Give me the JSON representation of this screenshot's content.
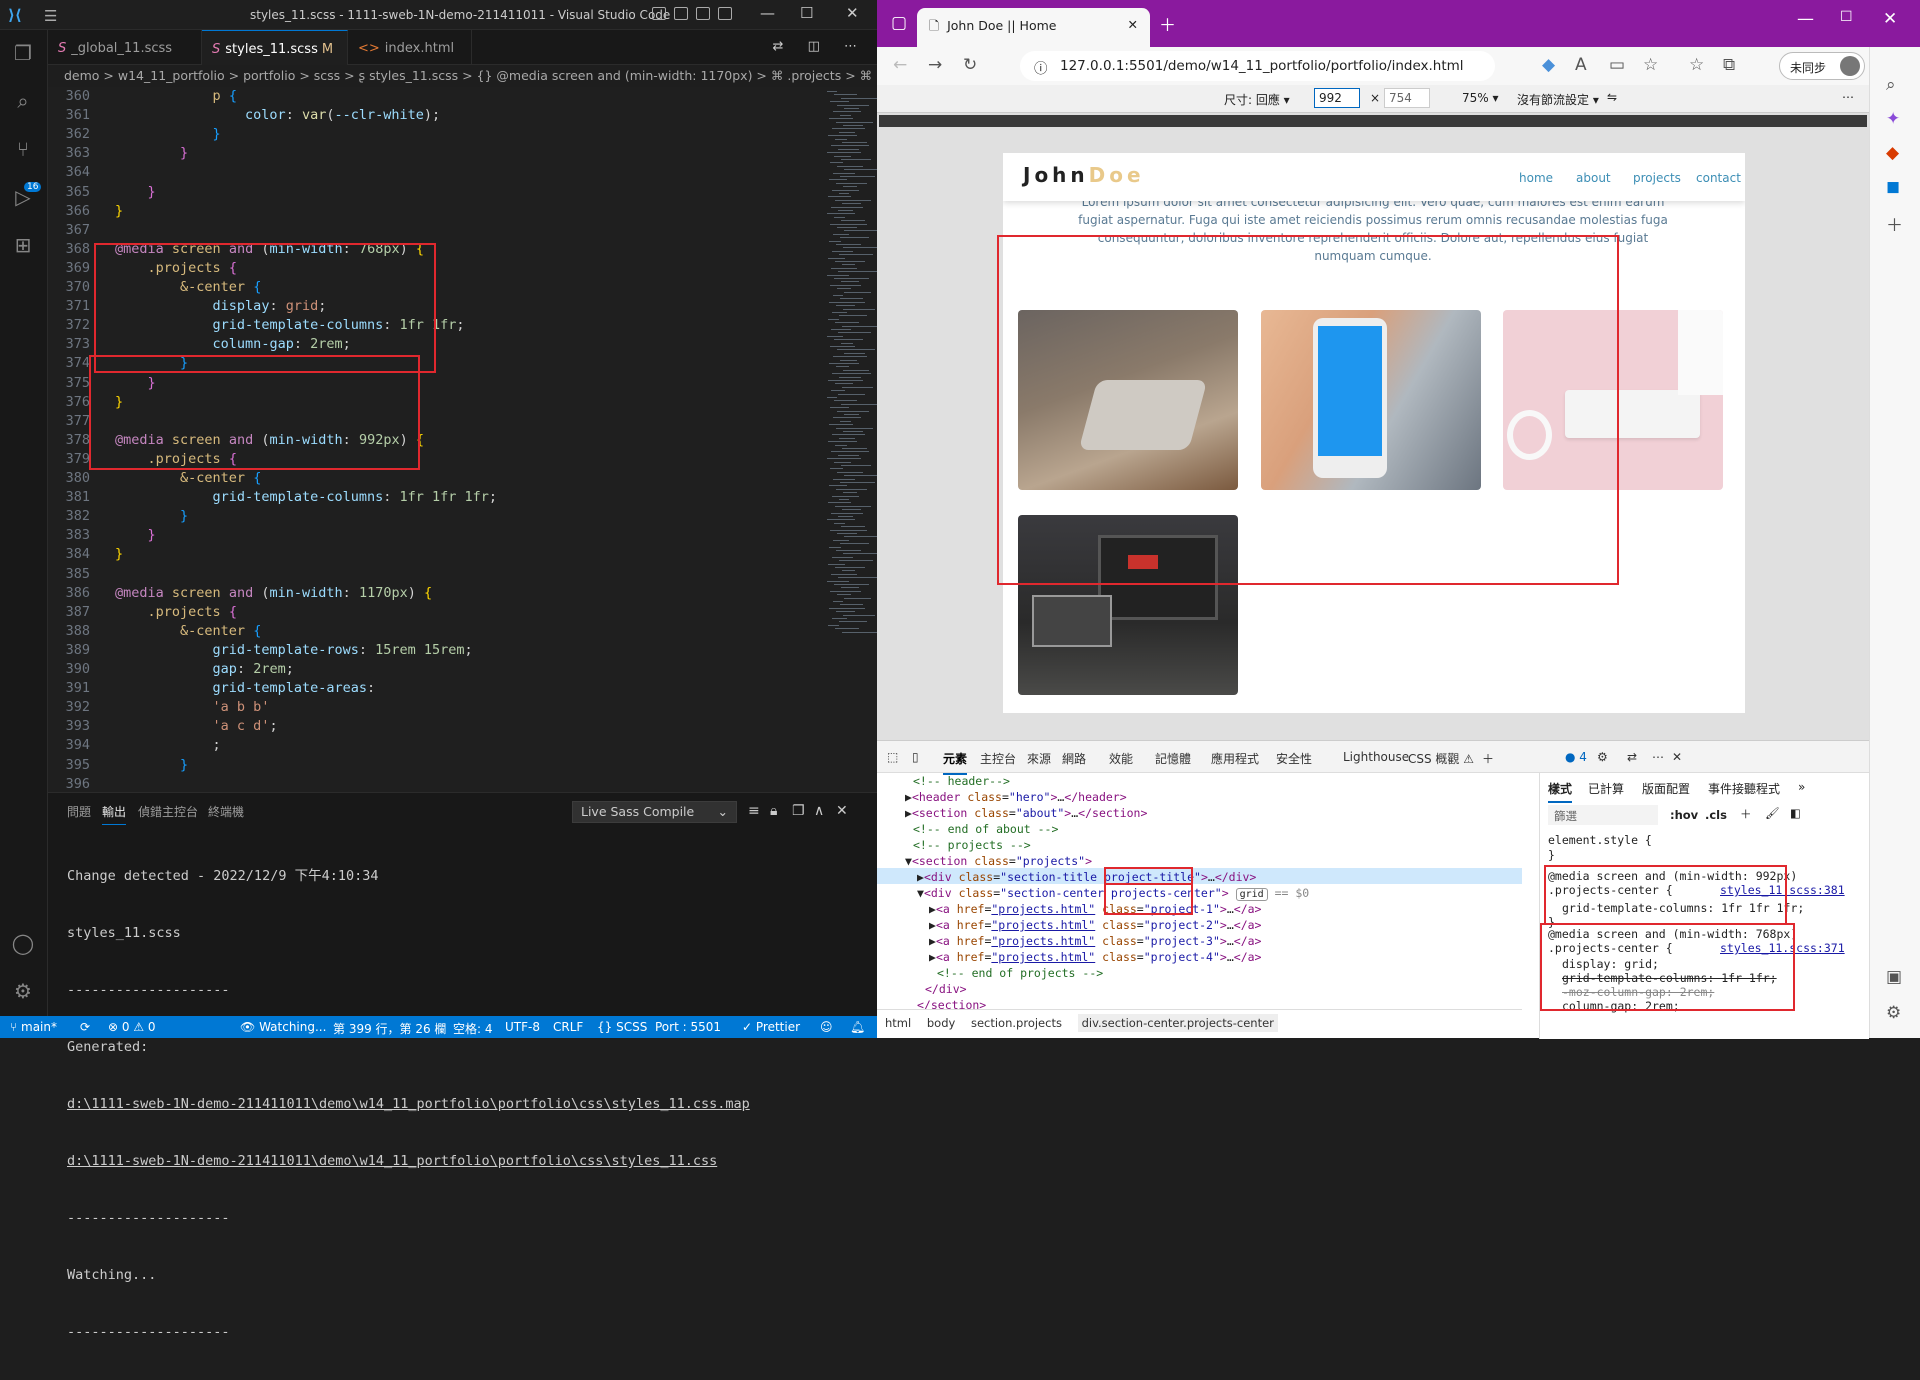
{
  "vscode": {
    "window_title": "styles_11.scss - 1111-sweb-1N-demo-211411011 - Visual Studio Code",
    "tabs": [
      {
        "icon": "S",
        "label": "_global_11.scss",
        "modified": ""
      },
      {
        "icon": "S",
        "label": "styles_11.scss",
        "modified": "M"
      },
      {
        "icon": "<>",
        "label": "index.html",
        "modified": ""
      }
    ],
    "breadcrumb": "demo > w14_11_portfolio > portfolio > scss > ʂ styles_11.scss > {} @media screen and (min-width: 1170px) > ⌘ .projects > ⌘ .project",
    "scm_badge": "16",
    "line_numbers": [
      "360",
      "361",
      "362",
      "363",
      "364",
      "365",
      "366",
      "367",
      "368",
      "369",
      "370",
      "371",
      "372",
      "373",
      "374",
      "375",
      "376",
      "377",
      "378",
      "379",
      "380",
      "381",
      "382",
      "383",
      "384",
      "385",
      "386",
      "387",
      "388",
      "389",
      "390",
      "391",
      "392",
      "393",
      "394",
      "395",
      "396"
    ],
    "panel": {
      "tabs": [
        "問題",
        "輸出",
        "偵錯主控台",
        "終端機"
      ],
      "output_channel": "Live Sass Compile",
      "output_lines": [
        "Change detected - 2022/12/9 下午4:10:34",
        "styles_11.scss",
        "--------------------",
        "Generated:",
        "d:\\1111-sweb-1N-demo-211411011\\demo\\w14_11_portfolio\\portfolio\\css\\styles_11.css.map",
        "d:\\1111-sweb-1N-demo-211411011\\demo\\w14_11_portfolio\\portfolio\\css\\styles_11.css",
        "--------------------",
        "Watching...",
        "--------------------"
      ]
    },
    "status": {
      "branch": "main*",
      "errors": "⊗ 0 ⚠ 0",
      "watching": "Watching...",
      "position": "第 399 行，第 26 欄",
      "spaces": "空格: 4",
      "encoding": "UTF-8",
      "eol": "CRLF",
      "language": "{} SCSS",
      "port": "Port : 5501",
      "prettier": "✓ Prettier"
    },
    "colors": {
      "accent": "#0078d4",
      "highlight_box": "#e0282e"
    }
  },
  "edge": {
    "tab_title": "John Doe || Home",
    "url": "127.0.0.1:5501/demo/w14_11_portfolio/portfolio/index.html",
    "profile_label": "未同步",
    "device_toolbar": {
      "size_label": "尺寸: 回應",
      "width": "992",
      "height": "754",
      "zoom": "75%",
      "throttle": "沒有節流設定"
    },
    "page": {
      "logo_first": "John",
      "logo_last": "Doe",
      "nav": [
        "home",
        "about",
        "projects",
        "contact"
      ],
      "about_text": "Lorem ipsum dolor sit amet consectetur adipisicing elit. Vero quae, cum maiores est enim earum fugiat aspernatur. Fuga qui iste amet reiciendis possimus rerum omnis recusandae molestias fuga consequuntur, doloribus inventore reprehenderit officiis. Dolore aut, repellendus eius fugiat numquam cumque."
    },
    "devtools": {
      "tabs": [
        "元素",
        "主控台",
        "來源",
        "網路",
        "效能",
        "記憶體",
        "應用程式",
        "安全性",
        "Lighthouse",
        "CSS 概觀 ⚠"
      ],
      "issue_count": "4",
      "styles_tabs": [
        "樣式",
        "已計算",
        "版面配置",
        "事件接聽程式"
      ],
      "filter_placeholder": "篩選",
      "hov": ":hov",
      "cls": ".cls",
      "grid_badge": "grid",
      "crumbs": [
        "html",
        "body",
        "section.projects",
        "div.section-center.projects-center"
      ],
      "style_rules": {
        "element_style": "element.style {",
        "rule1_media": "@media screen and (min-width: 992px)",
        "rule1_selector": ".projects-center {",
        "rule1_link": "styles_11.scss:381",
        "rule1_decl": "grid-template-columns: 1fr 1fr 1fr;",
        "rule2_media": "@media screen and (min-width: 768px)",
        "rule2_selector": ".projects-center {",
        "rule2_link": "styles_11.scss:371",
        "rule2_decl1": "display: grid;",
        "rule2_decl2": "grid-template-columns: 1fr 1fr;",
        "rule2_decl3": "-moz-column-gap: 2rem;",
        "rule2_decl4": "column-gap: 2rem;"
      }
    }
  }
}
